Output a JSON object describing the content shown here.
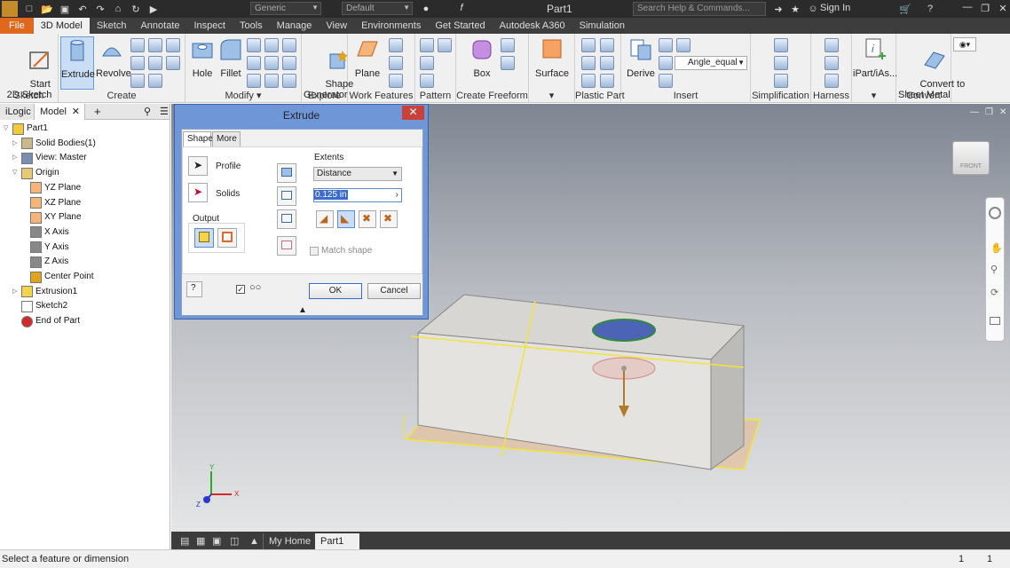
{
  "app": {
    "doc_title": "Part1",
    "search_placeholder": "Search Help & Commands...",
    "sign_in": "Sign In",
    "material_combo": "Generic",
    "appearance_combo": "Default"
  },
  "ribbon_tabs": [
    "File",
    "3D Model",
    "Sketch",
    "Annotate",
    "Inspect",
    "Tools",
    "Manage",
    "View",
    "Environments",
    "Get Started",
    "Autodesk A360",
    "Simulation"
  ],
  "ribbon": {
    "start_sketch": "Start\n2D Sketch",
    "extrude": "Extrude",
    "revolve": "Revolve",
    "hole": "Hole",
    "fillet": "Fillet",
    "shape_generator": "Shape\nGenerator",
    "plane": "Plane",
    "box": "Box",
    "surface": "Surface",
    "derive": "Derive",
    "param_combo": "Angle_equal",
    "ipart": "iPart/iAs...",
    "convert": "Convert to\nSheet Metal",
    "groups": {
      "sketch": "Sketch",
      "create": "Create",
      "modify": "Modify",
      "explore": "Explore",
      "work_features": "Work Features",
      "pattern": "Pattern",
      "create_freeform": "Create Freeform",
      "plastic_part": "Plastic Part",
      "insert": "Insert",
      "simplification": "Simplification",
      "harness": "Harness",
      "convert": "Convert"
    }
  },
  "browser": {
    "tabs": [
      "iLogic",
      "Model"
    ],
    "tree": [
      {
        "label": "Part1",
        "level": 0,
        "icon": "part-icon"
      },
      {
        "label": "Solid Bodies(1)",
        "level": 1,
        "icon": "solid-bodies-icon"
      },
      {
        "label": "View: Master",
        "level": 1,
        "icon": "view-icon"
      },
      {
        "label": "Origin",
        "level": 1,
        "icon": "folder-icon"
      },
      {
        "label": "YZ Plane",
        "level": 2,
        "icon": "plane-icon"
      },
      {
        "label": "XZ Plane",
        "level": 2,
        "icon": "plane-icon"
      },
      {
        "label": "XY Plane",
        "level": 2,
        "icon": "plane-icon"
      },
      {
        "label": "X Axis",
        "level": 2,
        "icon": "axis-icon"
      },
      {
        "label": "Y Axis",
        "level": 2,
        "icon": "axis-icon"
      },
      {
        "label": "Z Axis",
        "level": 2,
        "icon": "axis-icon"
      },
      {
        "label": "Center Point",
        "level": 2,
        "icon": "point-icon"
      },
      {
        "label": "Extrusion1",
        "level": 1,
        "icon": "extrusion-icon"
      },
      {
        "label": "Sketch2",
        "level": 1,
        "icon": "sketch-icon"
      },
      {
        "label": "End of Part",
        "level": 1,
        "icon": "end-of-part-icon"
      }
    ]
  },
  "dialog": {
    "title": "Extrude",
    "tabs": [
      "Shape",
      "More"
    ],
    "profile": "Profile",
    "solids": "Solids",
    "output": "Output",
    "extents": "Extents",
    "extent_type": "Distance",
    "distance": "0.125 in",
    "match_shape": "Match shape",
    "ok": "OK",
    "cancel": "Cancel"
  },
  "viewcube": {
    "face": "FRONT"
  },
  "triad": {
    "x": "X",
    "y": "Y",
    "z": "Z"
  },
  "doc_tabs": [
    "My Home",
    "Part1"
  ],
  "status": {
    "message": "Select a feature or dimension",
    "count1": "1",
    "count2": "1"
  },
  "colors": {
    "accent": "#e0671b",
    "selection": "#f2e43a",
    "dialog_frame": "#6f97d8",
    "ribbon_bg": "#f0f0f0"
  }
}
